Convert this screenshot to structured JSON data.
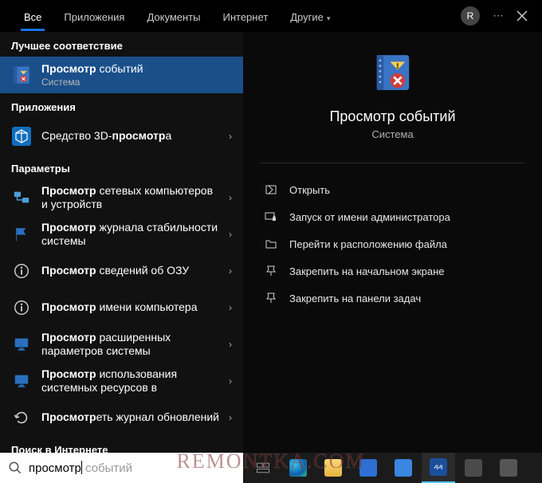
{
  "tabs": {
    "items": [
      "Все",
      "Приложения",
      "Документы",
      "Интернет",
      "Другие"
    ],
    "active_index": 0,
    "has_dropdown_index": 4
  },
  "avatar_letter": "R",
  "sections": {
    "best_match": "Лучшее соответствие",
    "apps": "Приложения",
    "settings": "Параметры",
    "web": "Поиск в Интернете"
  },
  "best_match_item": {
    "title_prefix_bold": "Просмотр",
    "title_rest": " событий",
    "subtitle": "Система"
  },
  "apps_items": [
    {
      "prefix": "Средство 3D-",
      "bold": "просмотр",
      "suffix": "а",
      "icon": "cube"
    }
  ],
  "settings_items": [
    {
      "bold": "Просмотр",
      "rest": " сетевых компьютеров и устройств",
      "icon": "network"
    },
    {
      "bold": "Просмотр",
      "rest": " журнала стабильности системы",
      "icon": "flag"
    },
    {
      "bold": "Просмотр",
      "rest": " сведений об ОЗУ",
      "icon": "info"
    },
    {
      "bold": "Просмотр",
      "rest": " имени компьютера",
      "icon": "info"
    },
    {
      "bold": "Просмотр",
      "rest": " расширенных параметров системы",
      "icon": "monitor"
    },
    {
      "bold": "Просмотр",
      "rest": " использования системных ресурсов в",
      "icon": "monitor"
    },
    {
      "bold": "Просмотр",
      "rest": "еть журнал обновлений",
      "icon": "refresh"
    }
  ],
  "preview": {
    "title": "Просмотр событий",
    "subtitle": "Система"
  },
  "actions": [
    {
      "label": "Открыть",
      "icon": "open"
    },
    {
      "label": "Запуск от имени администратора",
      "icon": "admin"
    },
    {
      "label": "Перейти к расположению файла",
      "icon": "folder"
    },
    {
      "label": "Закрепить на начальном экране",
      "icon": "pin"
    },
    {
      "label": "Закрепить на панели задач",
      "icon": "pin"
    }
  ],
  "search": {
    "typed": "просмотр",
    "suggestion": " событий"
  },
  "watermark": "REMONTKA.COM"
}
